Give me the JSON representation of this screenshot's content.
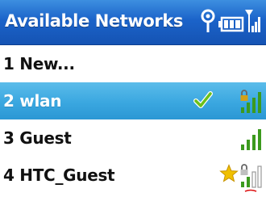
{
  "window": {
    "title": "Available Networks"
  },
  "status_bar": {
    "icons": [
      "antenna-icon",
      "battery-icon",
      "signal-strength-icon"
    ]
  },
  "networks": [
    {
      "label": "1 New...",
      "selected": false
    },
    {
      "label": "2 wlan",
      "selected": true,
      "status_icon": "checkmark-icon",
      "signal_icon": "wifi-signal-secured-icon"
    },
    {
      "label": "3 Guest",
      "selected": false,
      "signal_icon": "wifi-signal-icon"
    },
    {
      "label": "4 HTC_Guest",
      "selected": false,
      "status_icon": "star-icon",
      "signal_icon": "wifi-signal-secured-icon"
    }
  ],
  "colors": {
    "titlebar": "#1b63c9",
    "selection": "#3aa7e0",
    "signal_green": "#3c9a1e",
    "star": "#f0c000",
    "checkmark": "#6cc01a"
  }
}
